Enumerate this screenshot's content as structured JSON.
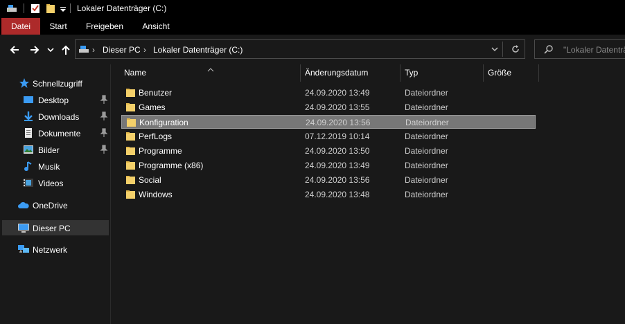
{
  "window": {
    "title": "Lokaler Datenträger (C:)"
  },
  "ribbon": {
    "tabs": [
      {
        "label": "Datei",
        "active": true
      },
      {
        "label": "Start"
      },
      {
        "label": "Freigeben"
      },
      {
        "label": "Ansicht"
      }
    ]
  },
  "address": {
    "crumbs": [
      "Dieser PC",
      "Lokaler Datenträger (C:)"
    ],
    "separator": "›"
  },
  "search": {
    "placeholder": "\"Lokaler Datenträ"
  },
  "nav": {
    "quick_access": "Schnellzugriff",
    "quick_items": [
      {
        "label": "Desktop",
        "icon": "desktop-icon",
        "pinned": true
      },
      {
        "label": "Downloads",
        "icon": "download-icon",
        "pinned": true
      },
      {
        "label": "Dokumente",
        "icon": "document-icon",
        "pinned": true
      },
      {
        "label": "Bilder",
        "icon": "pictures-icon",
        "pinned": true
      },
      {
        "label": "Musik",
        "icon": "music-icon",
        "pinned": false
      },
      {
        "label": "Videos",
        "icon": "video-icon",
        "pinned": false
      }
    ],
    "onedrive": "OneDrive",
    "this_pc": "Dieser PC",
    "network": "Netzwerk"
  },
  "columns": {
    "name": "Name",
    "date": "Änderungsdatum",
    "type": "Typ",
    "size": "Größe"
  },
  "files": [
    {
      "name": "Benutzer",
      "date": "24.09.2020 13:49",
      "type": "Dateiordner"
    },
    {
      "name": "Games",
      "date": "24.09.2020 13:55",
      "type": "Dateiordner"
    },
    {
      "name": "Konfiguration",
      "date": "24.09.2020 13:56",
      "type": "Dateiordner",
      "selected": true
    },
    {
      "name": "PerfLogs",
      "date": "07.12.2019 10:14",
      "type": "Dateiordner"
    },
    {
      "name": "Programme",
      "date": "24.09.2020 13:50",
      "type": "Dateiordner"
    },
    {
      "name": "Programme (x86)",
      "date": "24.09.2020 13:49",
      "type": "Dateiordner"
    },
    {
      "name": "Social",
      "date": "24.09.2020 13:56",
      "type": "Dateiordner"
    },
    {
      "name": "Windows",
      "date": "24.09.2020 13:48",
      "type": "Dateiordner"
    }
  ],
  "colors": {
    "accent": "#ad2a2a",
    "folder": "#f4d06a",
    "selection": "#777777",
    "link_blue": "#3b9bf3"
  }
}
